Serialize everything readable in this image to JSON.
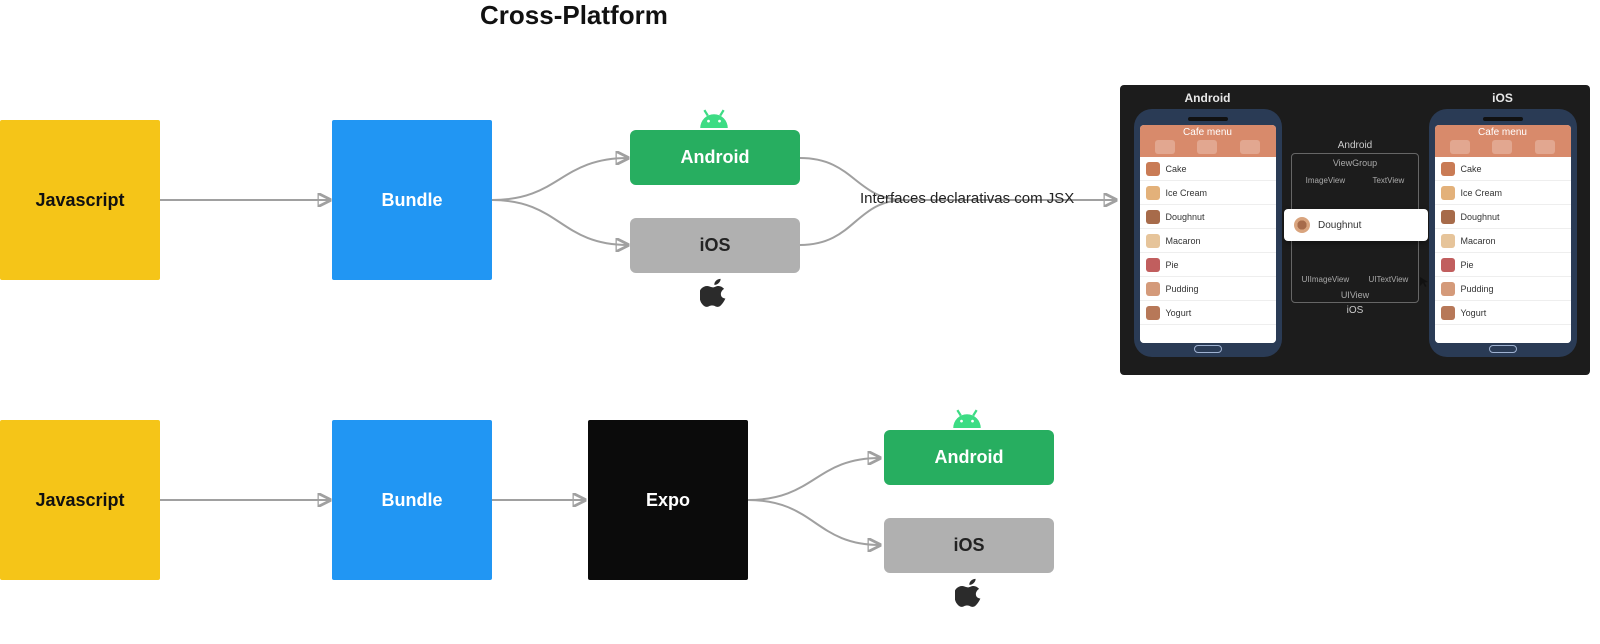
{
  "title": "Cross-Platform",
  "row1": {
    "js": "Javascript",
    "bundle": "Bundle",
    "android": "Android",
    "ios": "iOS",
    "jsx_label": "Interfaces declarativas com JSX"
  },
  "row2": {
    "js": "Javascript",
    "bundle": "Bundle",
    "expo": "Expo",
    "android": "Android",
    "ios": "iOS"
  },
  "colors": {
    "js": "#f5c518",
    "bundle": "#2196f3",
    "android": "#27ae60",
    "ios": "#b0b0b0",
    "expo": "#0b0b0b",
    "arrow": "#a0a0a0"
  },
  "mock": {
    "left_title": "Android",
    "right_title": "iOS",
    "screen_title": "Cafe menu",
    "menu_items": [
      "Cake",
      "Ice Cream",
      "Doughnut",
      "Macaron",
      "Pie",
      "Pudding",
      "Yogurt"
    ],
    "mid_top": "Android",
    "mid_viewgroup": "ViewGroup",
    "mid_imgview": "ImageView",
    "mid_textview": "TextView",
    "mid_card": "Doughnut",
    "mid_uiimg": "UIImageView",
    "mid_uitext": "UITextView",
    "mid_uiview": "UIView",
    "mid_bottom": "iOS"
  }
}
